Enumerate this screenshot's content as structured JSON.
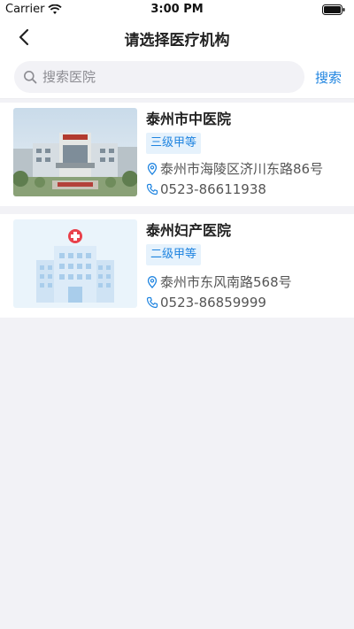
{
  "status_bar": {
    "carrier": "Carrier",
    "time": "3:00 PM"
  },
  "nav": {
    "title": "请选择医疗机构",
    "back_icon": "chevron-left-icon"
  },
  "search": {
    "placeholder": "搜索医院",
    "value": "",
    "button_label": "搜索"
  },
  "hospitals": [
    {
      "name": "泰州市中医院",
      "level": "三级甲等",
      "address": "泰州市海陵区济川东路86号",
      "phone": "0523-86611938",
      "image": "hospital-photo"
    },
    {
      "name": "泰州妇产医院",
      "level": "二级甲等",
      "address": "泰州市东风南路568号",
      "phone": "0523-86859999",
      "image": "hospital-building-illustration"
    }
  ],
  "colors": {
    "accent": "#1f84e0",
    "badge_bg": "#e6f2fc",
    "background": "#f2f2f6"
  }
}
